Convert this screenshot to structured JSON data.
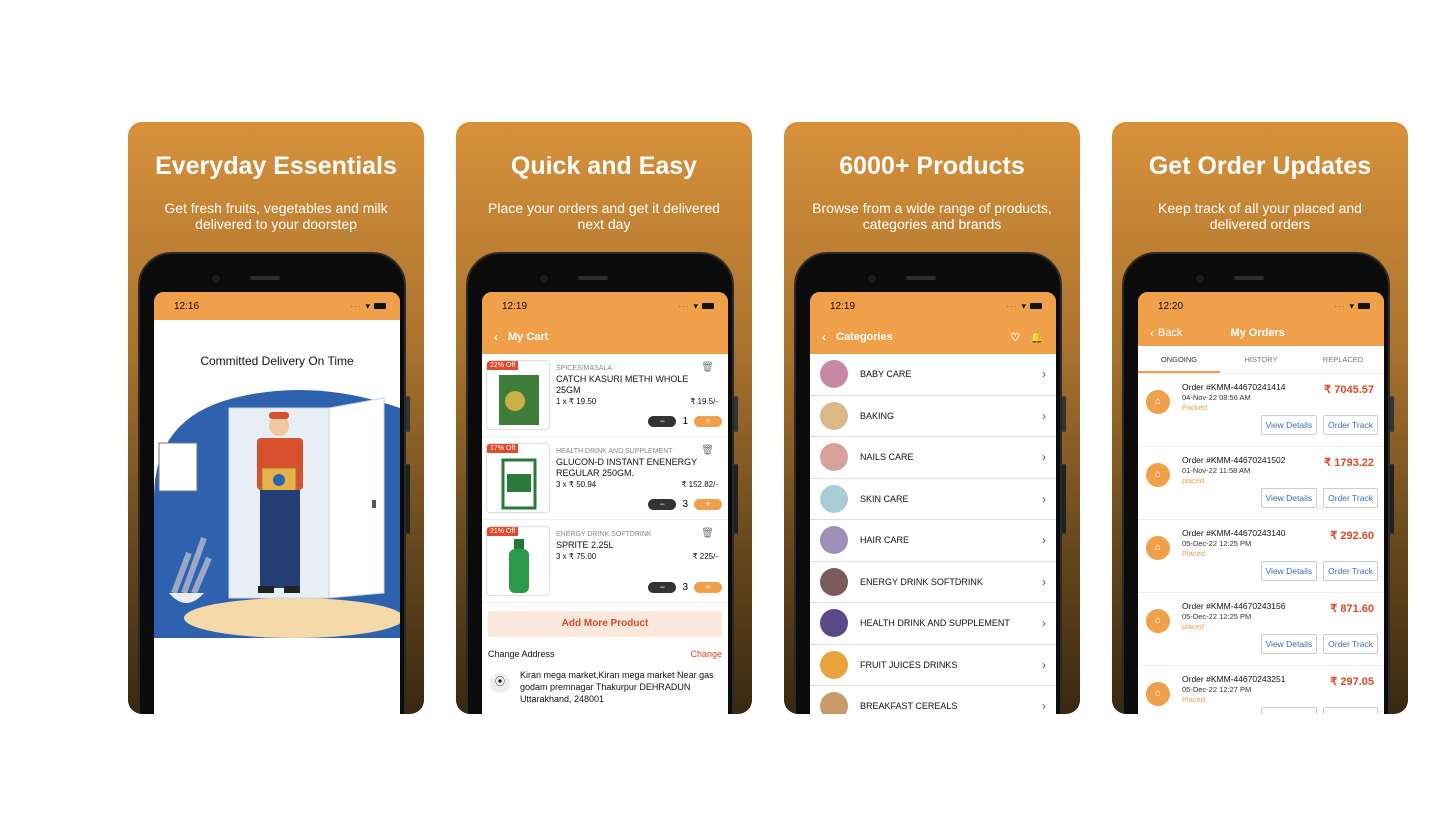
{
  "colors": {
    "accent": "#f0a04b",
    "price_red": "#d84a2a",
    "link_blue": "#3d6fb3"
  },
  "cards": [
    {
      "title": "Everyday Essentials",
      "subtitle": "Get fresh fruits, vegetables and milk delivered to your doorstep",
      "time": "12:16",
      "screen_heading": "Committed Delivery On Time"
    },
    {
      "title": "Quick and Easy",
      "subtitle": "Place your orders and get it delivered next day",
      "time": "12:19"
    },
    {
      "title": "6000+ Products",
      "subtitle": "Browse from a wide range of products, categories and brands",
      "time": "12:19"
    },
    {
      "title": "Get Order Updates",
      "subtitle": "Keep track of all your placed and delivered orders",
      "time": "12:20"
    }
  ],
  "cart": {
    "title": "My Cart",
    "items": [
      {
        "badge": "22% Off",
        "category": "SPICES/MASALA",
        "name": "CATCH KASURI METHI WHOLE 25GM",
        "qty_line": "1 x ₹ 19.50",
        "price": "₹ 19.5/-",
        "qty": "1"
      },
      {
        "badge": "17% Off",
        "category": "HEALTH DRINK AND SUPPLEMENT",
        "name": "GLUCON-D INSTANT ENENERGY REGULAR 250GM.",
        "qty_line": "3 x ₹ 50.94",
        "price": "₹ 152.82/-",
        "qty": "3"
      },
      {
        "badge": "21% Off",
        "category": "ENERGY DRINK SOFTDRINK",
        "name": "SPRITE 2.25L",
        "qty_line": "3 x ₹ 75.00",
        "price": "₹ 225/-",
        "qty": "3"
      }
    ],
    "add_more": "Add More Product",
    "change_address_label": "Change Address",
    "change_label": "Change",
    "address": "Kiran mega market,Kiran mega market Near gas godam premnagar Thakurpur DEHRADUN Uttarakhand, 248001"
  },
  "categories": {
    "title": "Categories",
    "items": [
      {
        "label": "BABY CARE",
        "color": "#c78aa5"
      },
      {
        "label": "BAKING",
        "color": "#d9b88a"
      },
      {
        "label": "NAILS CARE",
        "color": "#d6a29a"
      },
      {
        "label": "SKIN CARE",
        "color": "#a8cdd6"
      },
      {
        "label": "HAIR CARE",
        "color": "#9e8fb8"
      },
      {
        "label": "ENERGY DRINK SOFTDRINK",
        "color": "#7a5a5a"
      },
      {
        "label": "HEALTH DRINK AND SUPPLEMENT",
        "color": "#5b4a8a"
      },
      {
        "label": "FRUIT JUICES DRINKS",
        "color": "#e8a33b"
      },
      {
        "label": "BREAKFAST CEREALS",
        "color": "#c99a6a"
      }
    ]
  },
  "orders": {
    "back_label": "Back",
    "title": "My Orders",
    "tabs": [
      "ONGOING",
      "HISTORY",
      "REPLACED"
    ],
    "view_details_label": "View Details",
    "order_track_label": "Order Track",
    "items": [
      {
        "id": "Order #KMM-44670241414",
        "date": "04-Nov-22 08:56 AM",
        "status": "Packed",
        "amount": "₹ 7045.57"
      },
      {
        "id": "Order #KMM-44670241502",
        "date": "01-Nov-22 11:58 AM",
        "status": "placed",
        "amount": "₹ 1793.22"
      },
      {
        "id": "Order #KMM-44670243140",
        "date": "05-Dec-22 12:25 PM",
        "status": "Placed",
        "amount": "₹ 292.60"
      },
      {
        "id": "Order #KMM-44670243156",
        "date": "05-Dec-22 12:25 PM",
        "status": "placed",
        "amount": "₹ 871.60"
      },
      {
        "id": "Order #KMM-44670243251",
        "date": "05-Dec-22 12:27 PM",
        "status": "Placed",
        "amount": "₹ 297.05"
      }
    ]
  }
}
